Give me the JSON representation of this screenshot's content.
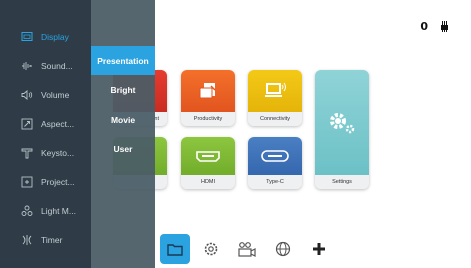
{
  "status": {
    "indicator_text": "0",
    "power_icon": "plug-icon"
  },
  "sidebar": {
    "items": [
      {
        "label": "Display",
        "icon": "display-icon",
        "active": true
      },
      {
        "label": "Sound...",
        "icon": "sound-icon"
      },
      {
        "label": "Volume",
        "icon": "volume-icon"
      },
      {
        "label": "Aspect...",
        "icon": "aspect-icon"
      },
      {
        "label": "Keysto...",
        "icon": "keystone-icon"
      },
      {
        "label": "Project...",
        "icon": "projection-icon"
      },
      {
        "label": "Light M...",
        "icon": "light-mode-icon"
      },
      {
        "label": "Timer",
        "icon": "timer-icon"
      }
    ]
  },
  "submenu": {
    "items": [
      {
        "label": "Presentation",
        "active": true
      },
      {
        "label": "Bright"
      },
      {
        "label": "Movie"
      },
      {
        "label": "User"
      }
    ]
  },
  "tiles": {
    "media_partial": "nt",
    "productivity": "Productivity",
    "connectivity": "Connectivity",
    "hdmi": "HDMI",
    "typec": "Type-C",
    "settings": "Settings"
  },
  "dock": {
    "items": [
      {
        "icon": "folder-icon",
        "active": true
      },
      {
        "icon": "gear-icon"
      },
      {
        "icon": "camera-icon"
      },
      {
        "icon": "globe-icon"
      },
      {
        "icon": "plus-icon"
      }
    ]
  },
  "colors": {
    "accent": "#2aa3e0",
    "panel": "#2f3c47"
  }
}
